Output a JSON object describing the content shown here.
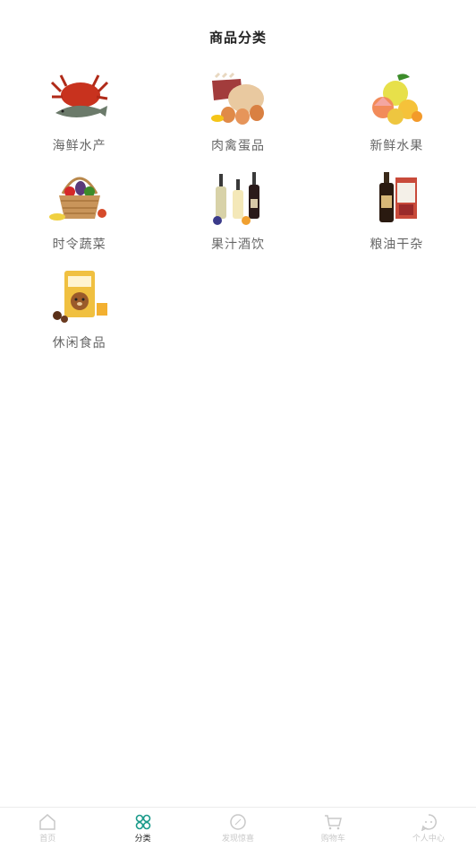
{
  "header": {
    "title": "商品分类"
  },
  "categories": [
    {
      "label": "海鲜水产",
      "icon": "seafood-icon"
    },
    {
      "label": "肉禽蛋品",
      "icon": "meat-poultry-eggs-icon"
    },
    {
      "label": "新鲜水果",
      "icon": "fresh-fruit-icon"
    },
    {
      "label": "时令蔬菜",
      "icon": "vegetables-basket-icon"
    },
    {
      "label": "果汁酒饮",
      "icon": "wine-juice-icon"
    },
    {
      "label": "粮油干杂",
      "icon": "grain-oil-icon"
    },
    {
      "label": "休闲食品",
      "icon": "snack-food-icon"
    }
  ],
  "tabbar": {
    "items": [
      {
        "label": "首页",
        "icon": "home-icon",
        "active": false
      },
      {
        "label": "分类",
        "icon": "category-icon",
        "active": true
      },
      {
        "label": "发现惊喜",
        "icon": "compass-icon",
        "active": false
      },
      {
        "label": "购物车",
        "icon": "cart-icon",
        "active": false
      },
      {
        "label": "个人中心",
        "icon": "chat-person-icon",
        "active": false
      }
    ]
  },
  "colors": {
    "accent": "#1a9a8a",
    "inactive": "#c8c8c8"
  }
}
